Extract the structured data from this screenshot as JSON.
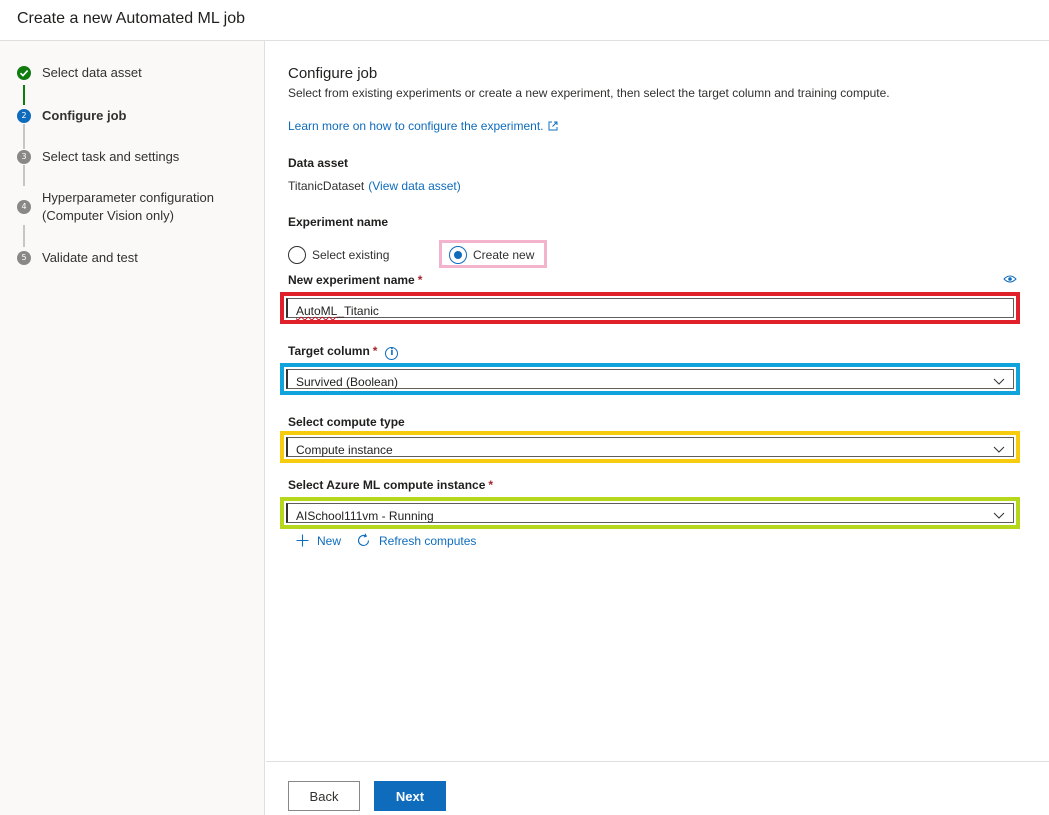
{
  "header": {
    "title": "Create a new Automated ML job"
  },
  "steps": [
    {
      "number": "",
      "label": "Select data asset",
      "state": "done"
    },
    {
      "number": "2",
      "label": "Configure job",
      "state": "current"
    },
    {
      "number": "3",
      "label": "Select task and settings",
      "state": "todo"
    },
    {
      "number": "4",
      "label": "Hyperparameter configuration",
      "label2": "(Computer Vision only)",
      "state": "todo"
    },
    {
      "number": "5",
      "label": "Validate and test",
      "state": "todo"
    }
  ],
  "main": {
    "title": "Configure job",
    "description": "Select from existing experiments or create a new experiment, then select the target column and training compute.",
    "learn_link": "Learn more on how to configure the experiment.",
    "data_asset_label": "Data asset",
    "data_asset_value": "TitanicDataset",
    "data_asset_link": "(View data asset)",
    "experiment_name_label": "Experiment name",
    "radio_existing": "Select existing",
    "radio_new": "Create new",
    "new_experiment_label": "New experiment name",
    "new_experiment_value_part1": "AutoML",
    "new_experiment_value_part2": "_Titanic",
    "target_column_label": "Target column",
    "target_column_value": "Survived (Boolean)",
    "compute_type_label": "Select compute type",
    "compute_type_value": "Compute instance",
    "compute_instance_label": "Select Azure ML compute instance",
    "compute_instance_value": "AISchool111vm - Running",
    "new_action": "New",
    "refresh_action": "Refresh computes",
    "required_mark": "*"
  },
  "footer": {
    "back_label": "Back",
    "next_label": "Next"
  },
  "colors": {
    "highlight_pink": "#f4b3cc",
    "highlight_red": "#e0202a",
    "highlight_blue": "#10a3dc",
    "highlight_yellow": "#f7cb10",
    "highlight_green": "#b5d71c",
    "accent": "#0f6cbd"
  }
}
